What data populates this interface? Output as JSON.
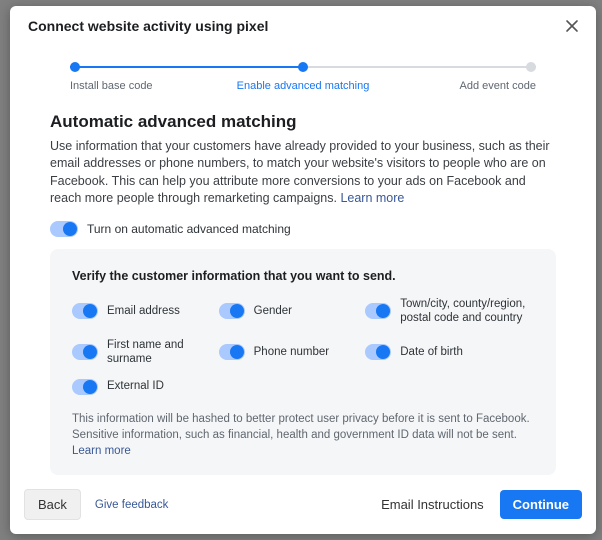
{
  "modal": {
    "title": "Connect website activity using pixel"
  },
  "stepper": {
    "steps": [
      {
        "label": "Install base code",
        "active": true
      },
      {
        "label": "Enable advanced matching",
        "active": true
      },
      {
        "label": "Add event code",
        "active": false
      }
    ],
    "progress_percent": 50
  },
  "main": {
    "heading": "Automatic advanced matching",
    "description": "Use information that your customers have already provided to your business, such as their email addresses or phone numbers, to match your website's visitors to people who are on Facebook. This can help you attribute more conversions to your ads on Facebook and reach more people through remarketing campaigns. ",
    "learn_more": "Learn more",
    "main_toggle_label": "Turn on automatic advanced matching"
  },
  "card": {
    "title": "Verify the customer information that you want to send.",
    "options": [
      {
        "label": "Email address"
      },
      {
        "label": "Gender"
      },
      {
        "label": "Town/city, county/region, postal code and country"
      },
      {
        "label": "First name and surname"
      },
      {
        "label": "Phone number"
      },
      {
        "label": "Date of birth"
      },
      {
        "label": "External ID"
      }
    ],
    "note": "This information will be hashed to better protect user privacy before it is sent to Facebook. Sensitive information, such as financial, health and government ID data will not be sent. ",
    "note_learn_more": "Learn more"
  },
  "footer": {
    "back": "Back",
    "feedback": "Give feedback",
    "email_instructions": "Email Instructions",
    "continue": "Continue"
  }
}
